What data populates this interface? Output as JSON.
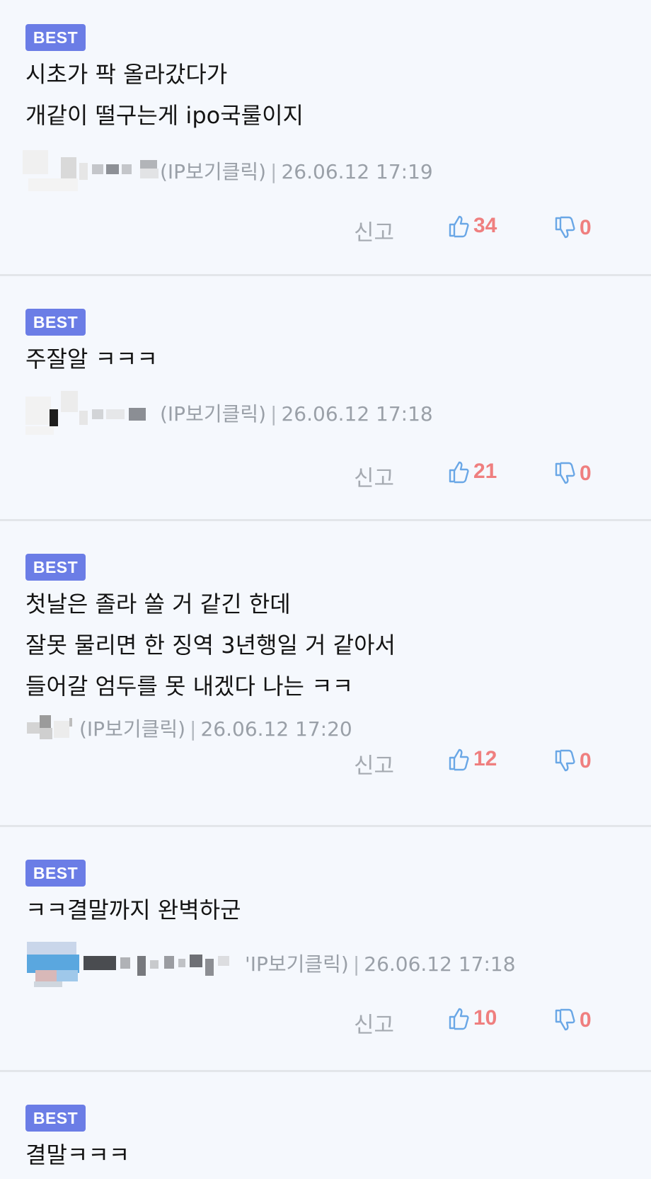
{
  "colors": {
    "badge": "#6b7de6",
    "count": "#ef7f7f",
    "icon": "#6aa7e6",
    "meta": "#9aa0a8"
  },
  "comments": [
    {
      "badge": "BEST",
      "lines": [
        "시초가 팍 올라갔다가",
        "개같이 떨구는게 ipo국룰이지"
      ],
      "ip_label": "(IP보기클릭)",
      "timestamp": "26.06.12 17:19",
      "report_label": "신고",
      "likes": "34",
      "dislikes": "0"
    },
    {
      "badge": "BEST",
      "lines": [
        "주잘알 ㅋㅋㅋ"
      ],
      "ip_label": "(IP보기클릭)",
      "timestamp": "26.06.12 17:18",
      "report_label": "신고",
      "likes": "21",
      "dislikes": "0"
    },
    {
      "badge": "BEST",
      "lines": [
        "첫날은 졸라 쏠 거 같긴 한데",
        "잘못 물리면 한 징역 3년행일 거 같아서",
        "들어갈 엄두를 못 내겠다 나는 ㅋㅋ"
      ],
      "ip_label": "(IP보기클릭)",
      "timestamp": "26.06.12 17:20",
      "report_label": "신고",
      "likes": "12",
      "dislikes": "0"
    },
    {
      "badge": "BEST",
      "lines": [
        "ㅋㅋ결말까지 완벽하군"
      ],
      "ip_label": "'IP보기클릭)",
      "timestamp": "26.06.12 17:18",
      "report_label": "신고",
      "likes": "10",
      "dislikes": "0"
    },
    {
      "badge": "BEST",
      "lines": [
        "결말ㅋㅋㅋ"
      ]
    }
  ]
}
